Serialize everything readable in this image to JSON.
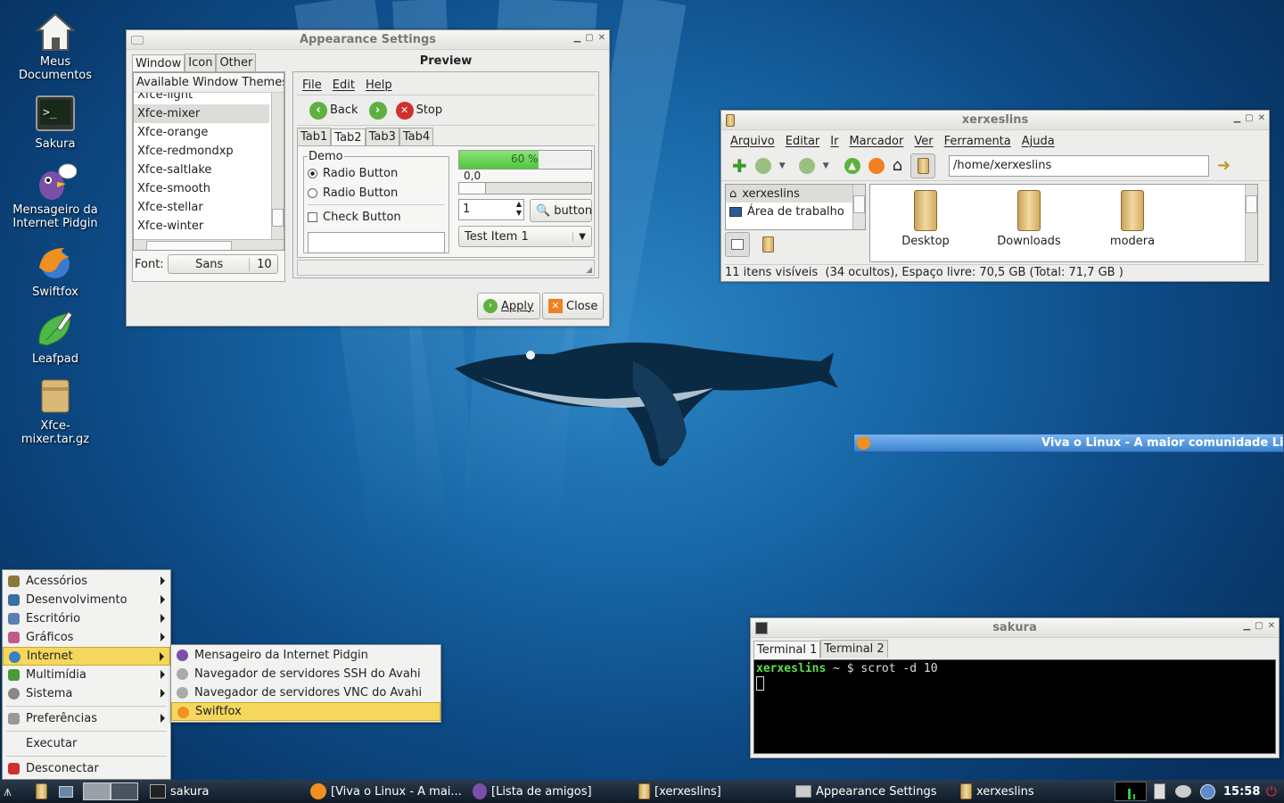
{
  "desktop": {
    "icons": [
      {
        "label": "Meus Documentos",
        "icon": "home-icon"
      },
      {
        "label": "Sakura",
        "icon": "terminal-icon"
      },
      {
        "label": "Mensageiro da Internet Pidgin",
        "icon": "pidgin-icon"
      },
      {
        "label": "Swiftfox",
        "icon": "swiftfox-icon"
      },
      {
        "label": "Leafpad",
        "icon": "leafpad-icon"
      },
      {
        "label": "Xfce-mixer.tar.gz",
        "icon": "archive-icon"
      }
    ]
  },
  "appearance": {
    "title": "Appearance Settings",
    "tabs": [
      "Window",
      "Icon",
      "Other"
    ],
    "themes_header": "Available Window Themes",
    "themes": [
      "Xfce-light",
      "Xfce-mixer",
      "Xfce-orange",
      "Xfce-redmondxp",
      "Xfce-saltlake",
      "Xfce-smooth",
      "Xfce-stellar",
      "Xfce-winter"
    ],
    "selected_theme": "Xfce-mixer",
    "font_label": "Font:",
    "font_name": "Sans",
    "font_size": "10",
    "preview": {
      "title": "Preview",
      "menus": [
        "File",
        "Edit",
        "Help"
      ],
      "back": "Back",
      "stop": "Stop",
      "tabs": [
        "Tab1",
        "Tab2",
        "Tab3",
        "Tab4"
      ],
      "active_tab": "Tab2",
      "demo_label": "Demo",
      "radio1": "Radio Button",
      "radio2": "Radio Button",
      "check": "Check Button",
      "progress_text": "60 %",
      "progress": 0.6,
      "slider_value": "0,0",
      "spin_value": "1",
      "button_label": "button",
      "combo_value": "Test Item 1"
    },
    "apply": "Apply",
    "close": "Close"
  },
  "filemanager": {
    "title": "xerxeslins",
    "menus": [
      "Arquivo",
      "Editar",
      "Ir",
      "Marcador",
      "Ver",
      "Ferramenta",
      "Ajuda"
    ],
    "path": "/home/xerxeslins",
    "sidebar": [
      "xerxeslins",
      "Área de trabalho"
    ],
    "files": [
      "Desktop",
      "Downloads",
      "modera"
    ],
    "status": "11 itens visíveis  (34 ocultos), Espaço livre: 70,5 GB (Total: 71,7 GB )"
  },
  "browser_bar": {
    "title": "Viva o Linux - A maior comunidade Li"
  },
  "terminal": {
    "title": "sakura",
    "tabs": [
      "Terminal 1",
      "Terminal 2"
    ],
    "prompt_user": "xerxeslins",
    "prompt_rest": " ~ $ ",
    "command": "scrot -d 10"
  },
  "app_menu": {
    "items": [
      {
        "label": "Acessórios",
        "submenu": true,
        "color": "#8a7a3a"
      },
      {
        "label": "Desenvolvimento",
        "submenu": true,
        "color": "#3a6ea5"
      },
      {
        "label": "Escritório",
        "submenu": true,
        "color": "#5a7fb0"
      },
      {
        "label": "Gráficos",
        "submenu": true,
        "color": "#c05a8a"
      },
      {
        "label": "Internet",
        "submenu": true,
        "color": "#3a80c0",
        "highlight": true
      },
      {
        "label": "Multimídia",
        "submenu": true,
        "color": "#4a9a3a"
      },
      {
        "label": "Sistema",
        "submenu": true,
        "color": "#888888"
      }
    ],
    "preferences": "Preferências",
    "run": "Executar",
    "logout": "Desconectar"
  },
  "internet_submenu": {
    "items": [
      {
        "label": "Mensageiro da Internet Pidgin",
        "icon": "pidgin-icon"
      },
      {
        "label": "Navegador de servidores SSH do Avahi",
        "icon": "avahi-icon"
      },
      {
        "label": "Navegador de servidores VNC do Avahi",
        "icon": "avahi-icon"
      },
      {
        "label": "Swiftfox",
        "icon": "swiftfox-icon",
        "highlight": true
      }
    ]
  },
  "taskbar": {
    "tasks": [
      "sakura",
      "[Viva o Linux - A mai...",
      "[Lista de amigos]",
      "[xerxeslins]",
      "Appearance Settings",
      "xerxeslins"
    ],
    "clock": "15:58"
  }
}
